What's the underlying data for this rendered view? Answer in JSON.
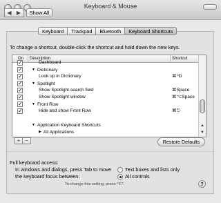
{
  "window": {
    "title": "Keyboard & Mouse",
    "show_all_label": "Show All",
    "nav_back": "◀",
    "nav_forward": "▶"
  },
  "tabs": [
    {
      "label": "Keyboard",
      "active": false
    },
    {
      "label": "Trackpad",
      "active": false
    },
    {
      "label": "Bluetooth",
      "active": false
    },
    {
      "label": "Keyboard Shortcuts",
      "active": true
    }
  ],
  "instruction": "To change a shortcut, double-click the shortcut and hold down the new keys.",
  "table": {
    "headers": {
      "on": "On",
      "description": "Description",
      "shortcut": "Shortcut"
    },
    "rows": [
      {
        "checked": true,
        "level": 1,
        "expander": "",
        "description": "Dashboard",
        "shortcut": ""
      },
      {
        "checked": true,
        "level": 0,
        "expander": "▼",
        "description": "Dictionary",
        "shortcut": ""
      },
      {
        "checked": true,
        "level": 1,
        "expander": "",
        "description": "Look up in Dictionary",
        "shortcut": "⌘^D"
      },
      {
        "checked": true,
        "level": 0,
        "expander": "▼",
        "description": "Spotlight",
        "shortcut": ""
      },
      {
        "checked": true,
        "level": 1,
        "expander": "",
        "description": "Show Spotlight search field",
        "shortcut": "⌘Space"
      },
      {
        "checked": true,
        "level": 1,
        "expander": "",
        "description": "Show Spotlight window",
        "shortcut": "⌘⌥Space"
      },
      {
        "checked": true,
        "level": 0,
        "expander": "▼",
        "description": "Front Row",
        "shortcut": ""
      },
      {
        "checked": true,
        "level": 1,
        "expander": "",
        "description": "Hide and show Front Row",
        "shortcut": "⌘⎋"
      },
      {
        "checked": false,
        "level": 0,
        "expander": "",
        "description": "",
        "shortcut": ""
      },
      {
        "checked": false,
        "level": 0,
        "expander": "▼",
        "description": "Application Keyboard Shortcuts",
        "shortcut": ""
      },
      {
        "checked": false,
        "level": 1,
        "expander": "▶",
        "description": "All Applications",
        "shortcut": ""
      }
    ]
  },
  "buttons": {
    "add": "+",
    "remove": "−",
    "restore_defaults": "Restore Defaults",
    "help": "?"
  },
  "full_keyboard_access": {
    "title": "Full keyboard access:",
    "description": "In windows and dialogs, press Tab to move the keyboard focus between:",
    "options": [
      {
        "label": "Text boxes and lists only",
        "selected": false
      },
      {
        "label": "All controls",
        "selected": true
      }
    ],
    "note": "To change this setting, press ^F7."
  }
}
